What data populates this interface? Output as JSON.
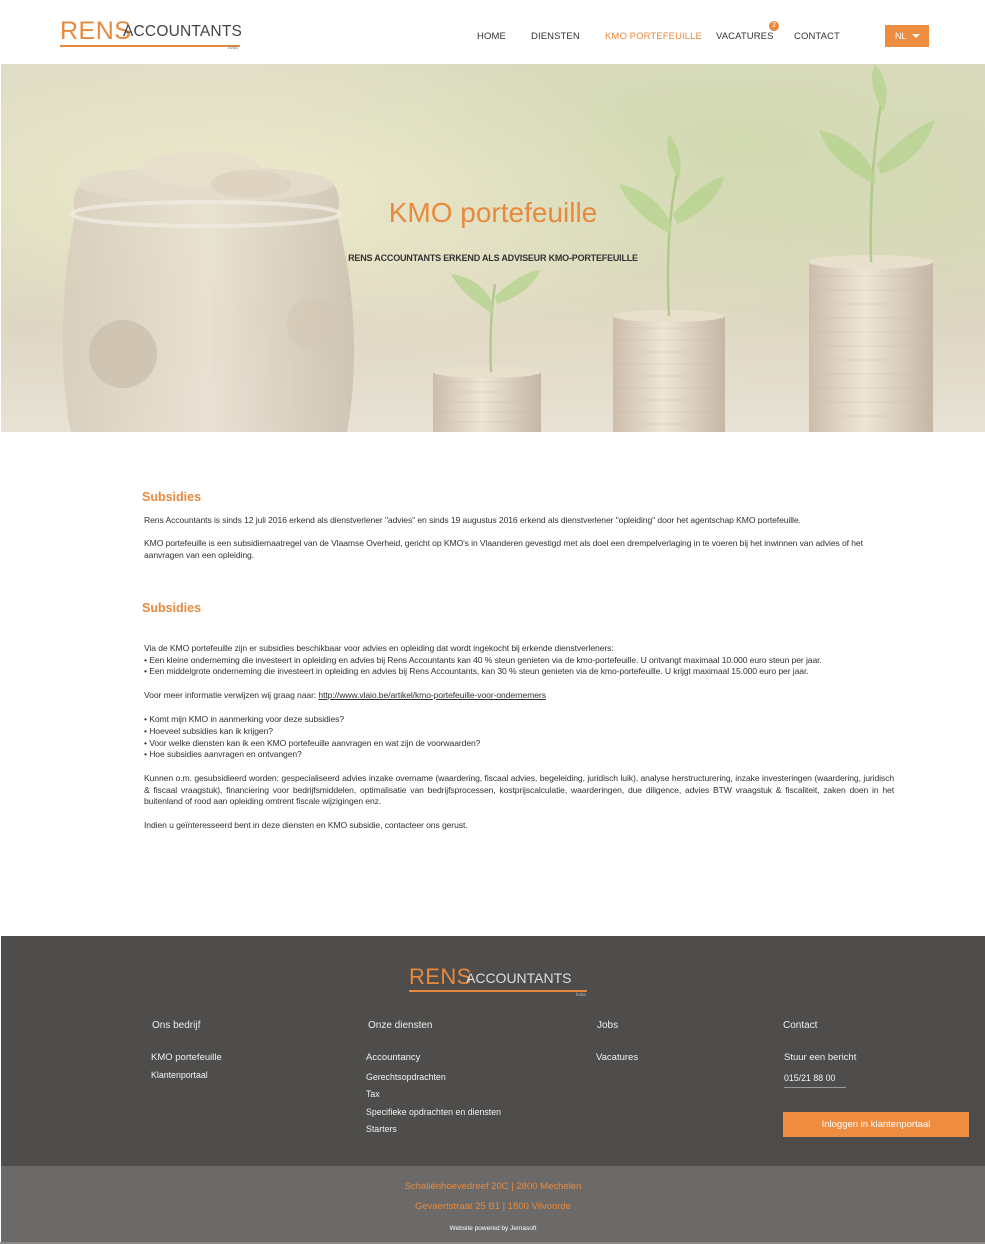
{
  "header": {
    "logo": {
      "rens": "RENS",
      "accountants": "ACCOUNTANTS",
      "suffix": "bvba"
    },
    "nav": [
      {
        "label": "HOME"
      },
      {
        "label": "DIENSTEN"
      },
      {
        "label": "KMO PORTEFEUILLE"
      },
      {
        "label": "VACATURES"
      },
      {
        "label": "CONTACT"
      }
    ],
    "vacatures_badge": "2",
    "language": "NL"
  },
  "hero": {
    "title": "KMO portefeuille",
    "subtitle": "RENS ACCOUNTANTS ERKEND ALS ADVISEUR KMO-PORTEFEUILLE"
  },
  "main": {
    "section1": {
      "title": "Subsidies",
      "p1": "Rens Accountants is sinds 12 juli 2016 erkend als dienstverlener \"advies\" en sinds 19 augustus 2016 erkend als dienstverlener \"opleiding\" door het agentschap KMO portefeuille.",
      "p2": "KMO portefeuille is een subsidiemaatregel van de Vlaamse Overheid, gericht op KMO's in Vlaanderen gevestigd met als doel een drempelverlaging in te voeren bij het inwinnen van advies of het aanvragen van een opleiding."
    },
    "section2": {
      "title": "Subsidies",
      "intro": "Via de KMO portefeuille zijn er subsidies beschikbaar voor advies en opleiding dat wordt ingekocht bij erkende dienstverleners:",
      "bullets_a": [
        "• Een kleine onderneming die investeert in opleiding en advies bij Rens Accountants kan 40 % steun genieten via de kmo-portefeuille. U ontvangt maximaal 10.000 euro steun per jaar.",
        "• Een middelgrote onderneming die investeert in opleiding en advies bij Rens Accountants, kan 30 % steun genieten via de kmo-portefeuille. U krijgt maximaal 15.000 euro per jaar."
      ],
      "info_prefix": "Voor meer informatie  verwijzen wij graag naar: ",
      "info_link": "http://www.vlaio.be/artikel/kmo-portefeuille-voor-ondernemers",
      "questions": [
        "• Komt mijn KMO in aanmerking voor deze subsidies?",
        "• Hoeveel subsidies kan ik krijgen?",
        "• Voor welke diensten kan ik een KMO portefeuille aanvragen en wat zijn de voorwaarden?",
        "• Hoe subsidies aanvragen en ontvangen?"
      ],
      "services": "Kunnen o.m. gesubsidieerd worden: gespecialiseerd advies inzake overname (waardering, fiscaal advies, begeleiding, juridisch luik), analyse herstructurering, inzake investeringen (waardering, juridisch & fiscaal vraagstuk), financiering voor bedrijfsmiddelen, optimalisatie van bedrijfsprocessen, kostprijscalculatie, waarderingen, due diligence, advies BTW vraagstuk & fiscaliteit, zaken doen in het buitenland of rood aan opleiding omtrent fiscale wijzigingen enz.",
      "closing": "Indien u geïnteresseerd bent in deze diensten en KMO subsidie, contacteer ons gerust."
    }
  },
  "footer": {
    "logo": {
      "rens": "RENS",
      "accountants": "ACCOUNTANTS",
      "suffix": "bvba"
    },
    "columns": {
      "company": {
        "heading": "Ons bedrijf",
        "links": [
          "KMO portefeuille",
          "Klantenportaal"
        ]
      },
      "services": {
        "heading": "Onze diensten",
        "links": [
          "Accountancy",
          "Gerechtsopdrachten",
          "Tax",
          "Specifieke opdrachten en diensten",
          "Starters"
        ]
      },
      "jobs": {
        "heading": "Jobs",
        "links": [
          "Vacatures"
        ]
      },
      "contact": {
        "heading": "Contact",
        "message": "Stuur een bericht",
        "phone": "015/21 88 00"
      }
    },
    "portal_button": "Inloggen in klantenportaal",
    "address1": "Schaliënhoevedreef 20C | 2800 Mechelen",
    "address2": "Gevaertstraat 25 B1 | 1800 Vilvoorde",
    "powered": "Website powered by Jemasoft"
  },
  "colors": {
    "accent": "#e9893d",
    "footer": "#4e4d4b",
    "bottombar": "#6b6a68"
  }
}
